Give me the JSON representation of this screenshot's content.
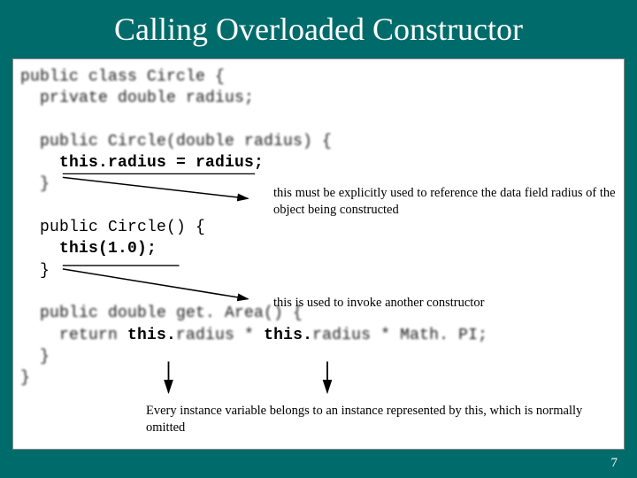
{
  "title": "Calling Overloaded Constructor",
  "code": {
    "l1": "public class Circle {",
    "l2": "  private double radius;",
    "l3": "",
    "l4": "  public Circle(double radius) {",
    "l5a": "    ",
    "l5b": "this.",
    "l5c": "radius = radius;",
    "l6": "  }",
    "l7": "",
    "l8": "  public Circle() {",
    "l9a": "    ",
    "l9b": "this(1.",
    "l9c": "0);",
    "l10": "  }",
    "l11": "",
    "l12": "  public double get. Area() {",
    "l13a": "    return ",
    "l13b": "this.",
    "l13c": "radius * ",
    "l13d": "this.",
    "l13e": "radius * Math. PI;",
    "l14": "  }",
    "l15": "}"
  },
  "annotations": {
    "a1": "this must be explicitly used  to reference the data field radius of the object being constructed",
    "a2": "this is used to invoke another constructor",
    "a3": "Every instance variable belongs to an instance represented by this, which is normally omitted"
  },
  "page": "7"
}
